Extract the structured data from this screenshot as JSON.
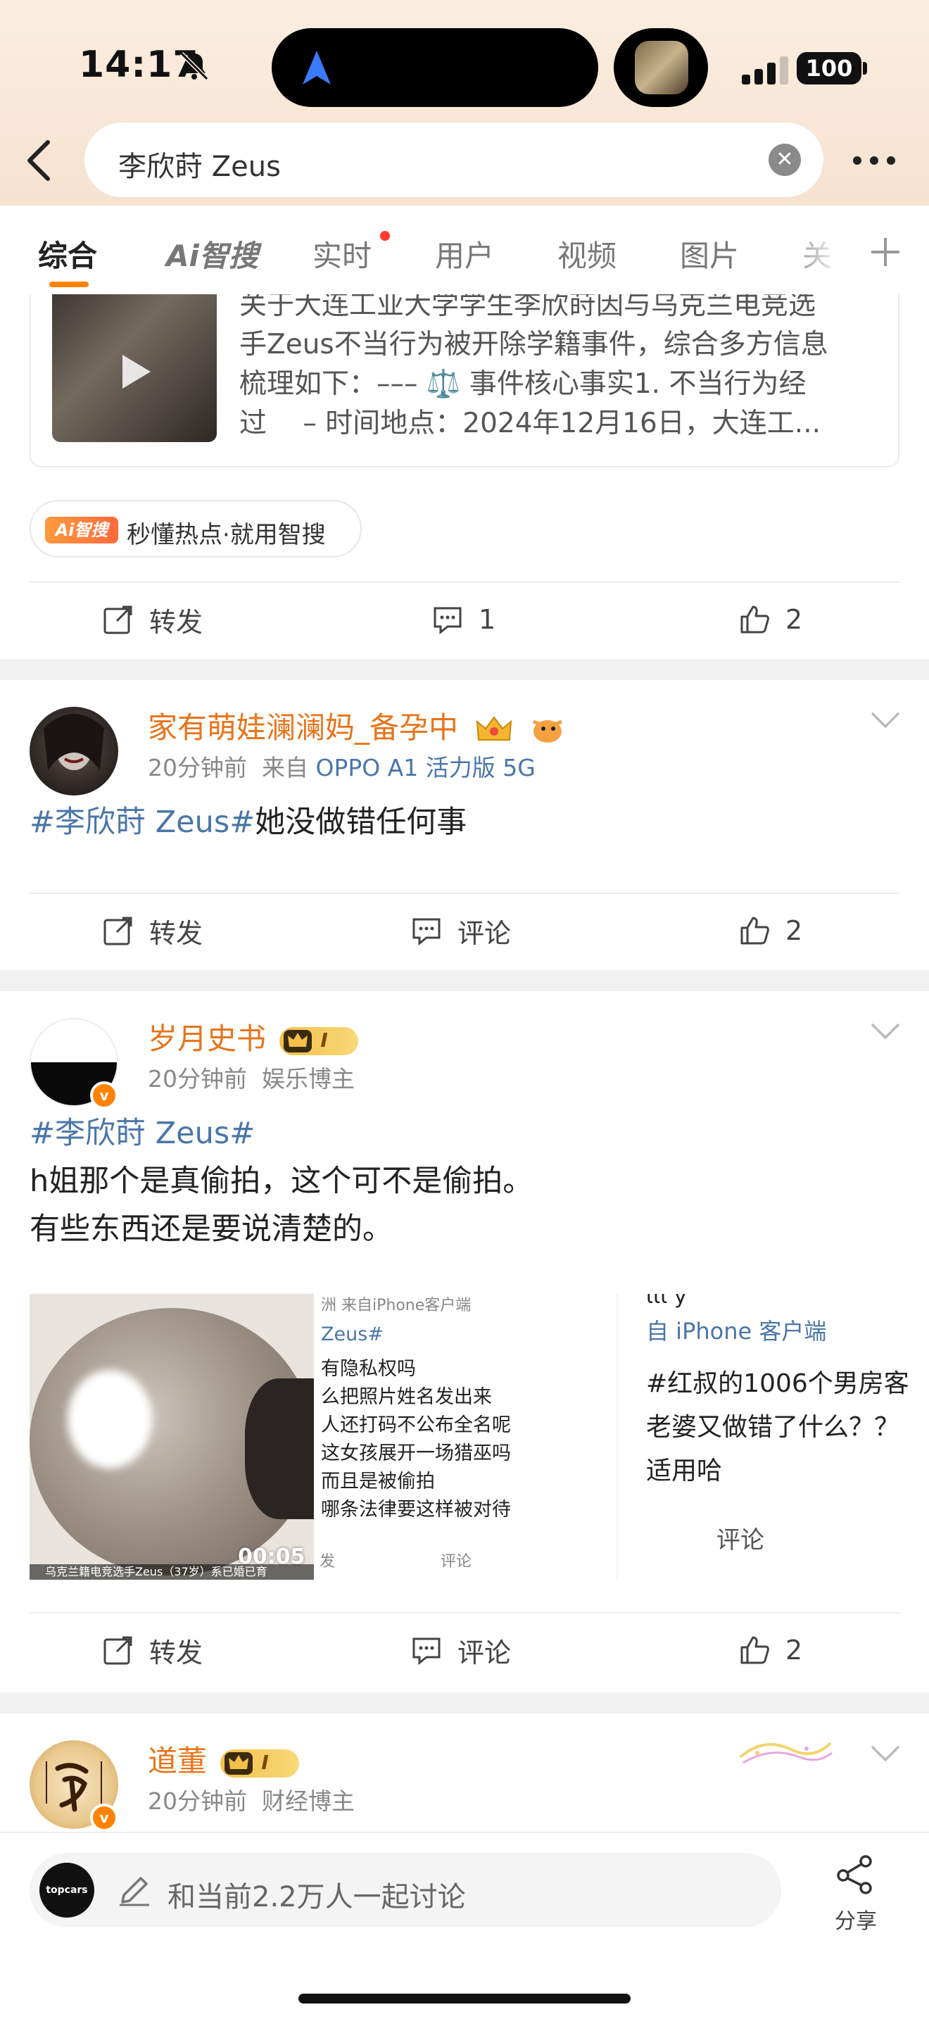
{
  "status_bar": {
    "time": "14:17",
    "battery": "100"
  },
  "search": {
    "query": "李欣莳 Zeus"
  },
  "tabs": [
    {
      "label": "综合"
    },
    {
      "label": "智搜",
      "ai_prefix": "Ai"
    },
    {
      "label": "实时"
    },
    {
      "label": "用户"
    },
    {
      "label": "视频"
    },
    {
      "label": "图片"
    },
    {
      "label": "关"
    }
  ],
  "top_card": {
    "lines": [
      "关于大连工业大学学生李欣莳因与乌克兰电竞选",
      "手Zeus不当行为被开除学籍事件，综合多方信息",
      "梳理如下：––– ⚖️ 事件核心事实1. 不当行为经",
      "过　 – 时间地点：2024年12月16日，大连工..."
    ]
  },
  "ai_chip": {
    "badge": "Ai智搜",
    "text": "秒懂热点·就用智搜"
  },
  "actions_1": {
    "repost": "转发",
    "comment": "1",
    "like": "2"
  },
  "post1": {
    "username": "家有萌娃澜澜妈_备孕中",
    "time": "20分钟前",
    "source_prefix": "来自",
    "source": "OPPO A1 活力版 5G",
    "hashtag": "#李欣莳 Zeus#",
    "text": "她没做错任何事"
  },
  "actions_2": {
    "repost": "转发",
    "comment": "评论",
    "like": "2"
  },
  "post2": {
    "username": "岁月史书",
    "level": "I",
    "time": "20分钟前",
    "role": "娱乐博主",
    "hashtag": "#李欣莳 Zeus#",
    "line1": "h姐那个是真偷拍，这个可不是偷拍。",
    "line2": "有些东西还是要说清楚的。",
    "video_time": "00:05",
    "video_caption": "乌克兰籍电竞选手Zeus（37岁）系已婚已育",
    "shot2_lines": [
      "洲 来自iPhone客户端",
      "Zeus#",
      "有隐私权吗",
      "么把照片姓名发出来",
      "人还打码不公布全名呢",
      "这女孩展开一场猎巫吗",
      "而且是被偷拍",
      "哪条法律要这样被对待"
    ],
    "shot2_footer": [
      "发",
      "评论"
    ],
    "shot3_lines": [
      "ιιι y",
      "自 iPhone 客户端",
      "#红叔的1006个男房客",
      "老婆又做错了什么？？",
      "适用哈"
    ],
    "shot3_comment": "评论"
  },
  "actions_3": {
    "repost": "转发",
    "comment": "评论",
    "like": "2"
  },
  "post3": {
    "username": "道董",
    "level": "I",
    "time": "20分钟前",
    "role": "财经博主"
  },
  "bottom_bar": {
    "avatar_text": "topcars",
    "discuss_text": "和当前2.2万人一起讨论",
    "share_label": "分享"
  },
  "colors": {
    "accent": "#ff8200",
    "username": "#e8741a",
    "link": "#4a76a8"
  }
}
